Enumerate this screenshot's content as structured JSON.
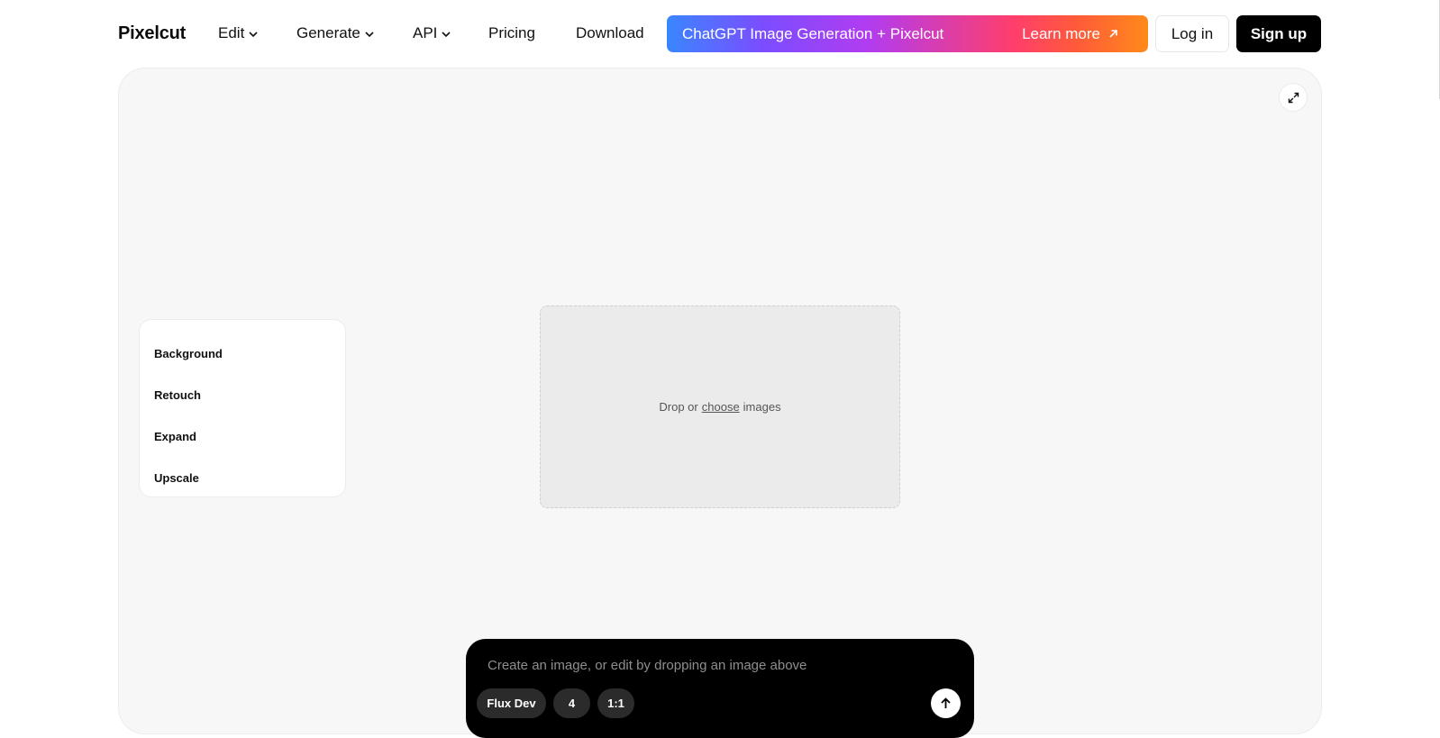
{
  "header": {
    "logo": "Pixelcut",
    "nav": [
      {
        "label": "Edit",
        "has_dropdown": true
      },
      {
        "label": "Generate",
        "has_dropdown": true
      },
      {
        "label": "API",
        "has_dropdown": true
      },
      {
        "label": "Pricing",
        "has_dropdown": false
      },
      {
        "label": "Download",
        "has_dropdown": false
      }
    ],
    "promo": {
      "text": "ChatGPT Image Generation + Pixelcut",
      "cta": "Learn more",
      "cta_icon": "arrow-up-right-icon"
    },
    "login_label": "Log in",
    "signup_label": "Sign up"
  },
  "canvas": {
    "expand_icon": "expand-icon",
    "side_menu": [
      {
        "label": "Background"
      },
      {
        "label": "Retouch"
      },
      {
        "label": "Expand"
      },
      {
        "label": "Upscale"
      }
    ],
    "dropzone": {
      "prefix": "Drop or",
      "link": "choose",
      "suffix": "images"
    }
  },
  "prompt": {
    "placeholder": "Create an image, or edit by dropping an image above",
    "value": "",
    "chips": [
      {
        "label": "Flux Dev"
      },
      {
        "label": "4"
      },
      {
        "label": "1:1"
      }
    ],
    "send_icon": "arrow-up-icon"
  },
  "colors": {
    "signup_bg": "#000000",
    "canvas_bg": "#f7f7f7",
    "prompt_bg": "#000000",
    "promo_gradient_start": "#3a86ff",
    "promo_gradient_end": "#ff8a1a"
  }
}
